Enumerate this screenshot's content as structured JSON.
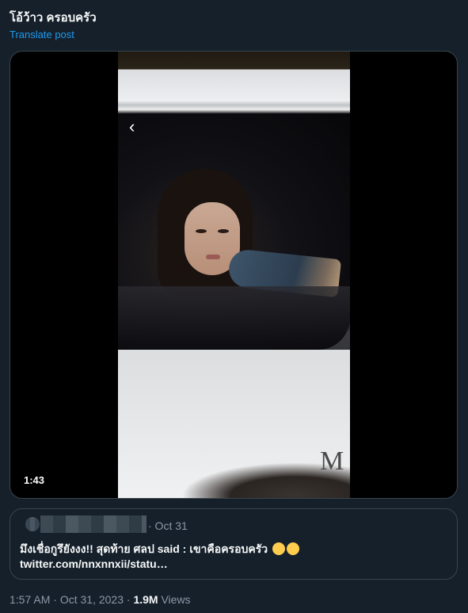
{
  "post": {
    "text": "โอ้ว้าว ครอบครัว",
    "translate_label": "Translate post"
  },
  "video": {
    "duration": "1:43",
    "brand_text": "M",
    "back_icon": "chevron-left-icon"
  },
  "quote": {
    "date": "· Oct 31",
    "body": "มึงเชื่อกูรึยังงง!! สุดท้าย ศลป said : เขาคือครอบครัว",
    "emojis": [
      "persevering-face-emoji",
      "persevering-face-emoji"
    ],
    "link": "twitter.com/nnxnnxii/statu…"
  },
  "meta": {
    "time": "1:57 AM",
    "separator": "·",
    "date": "Oct 31, 2023",
    "views_count": "1.9M",
    "views_label": "Views"
  }
}
